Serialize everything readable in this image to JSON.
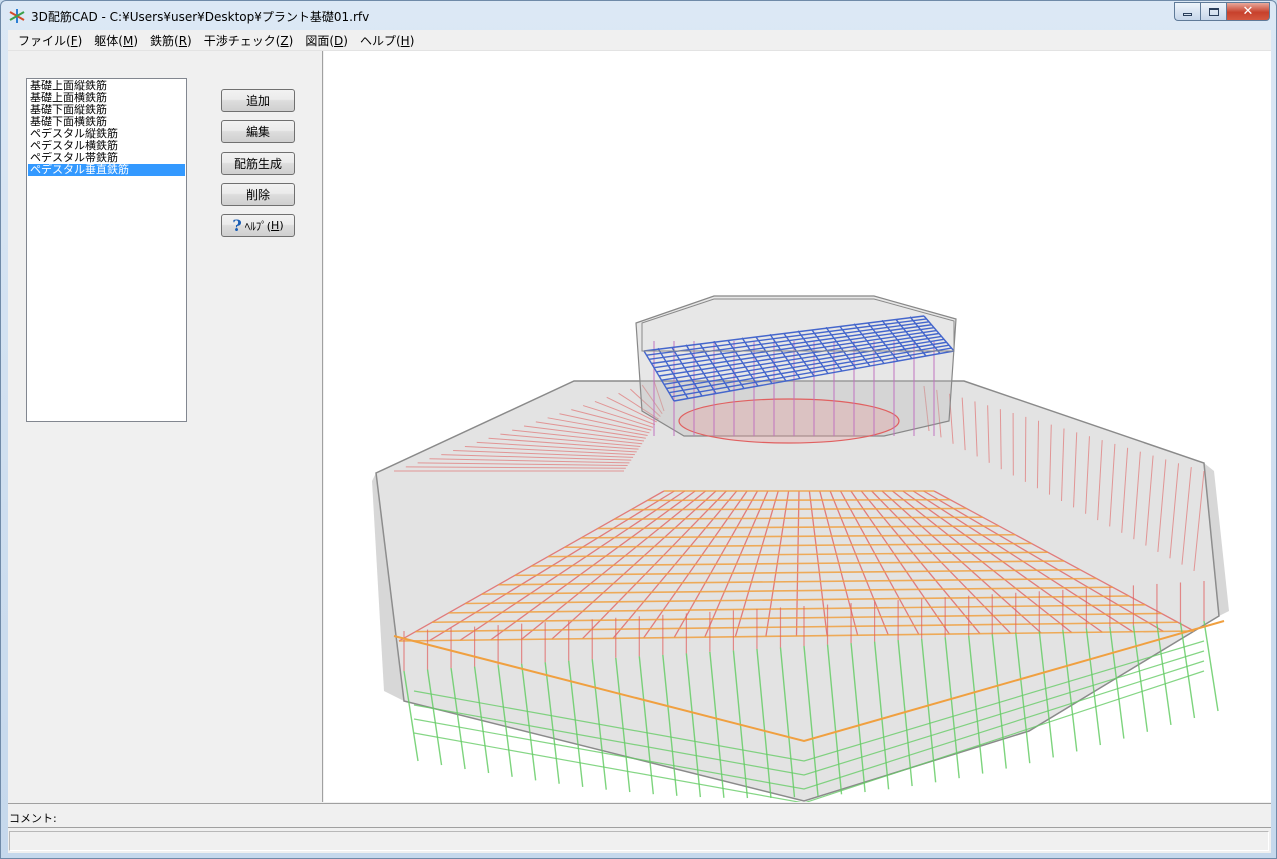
{
  "window": {
    "title": "3D配筋CAD - C:¥Users¥user¥Desktop¥プラント基礎01.rfv",
    "minimize_label": "",
    "maximize_label": "",
    "close_label": "✕"
  },
  "menu": [
    {
      "label": "ファイル(",
      "key": "F",
      "tail": ")"
    },
    {
      "label": "躯体(",
      "key": "M",
      "tail": ")"
    },
    {
      "label": "鉄筋(",
      "key": "R",
      "tail": ")"
    },
    {
      "label": "干渉チェック(",
      "key": "Z",
      "tail": ")"
    },
    {
      "label": "図面(",
      "key": "D",
      "tail": ")"
    },
    {
      "label": "ヘルプ(",
      "key": "H",
      "tail": ")"
    }
  ],
  "rebar_list": {
    "items": [
      "基礎上面縦鉄筋",
      "基礎上面横鉄筋",
      "基礎下面縦鉄筋",
      "基礎下面横鉄筋",
      "ペデスタル縦鉄筋",
      "ペデスタル横鉄筋",
      "ペデスタル帯鉄筋",
      "ペデスタル垂直鉄筋"
    ],
    "selected_index": 7
  },
  "buttons": {
    "add": "追加",
    "edit": "編集",
    "generate": "配筋生成",
    "delete": "削除",
    "help": "ﾍﾙﾌﾟ(",
    "help_key": "H",
    "help_tail": ")"
  },
  "comment": {
    "label": "コメント:"
  },
  "colors": {
    "selection": "#3399ff",
    "rebar_top": "#4466cc",
    "rebar_red": "#e06060",
    "rebar_orange": "#f0a040",
    "rebar_green": "#66cc66",
    "concrete": "#9a9a9a"
  }
}
